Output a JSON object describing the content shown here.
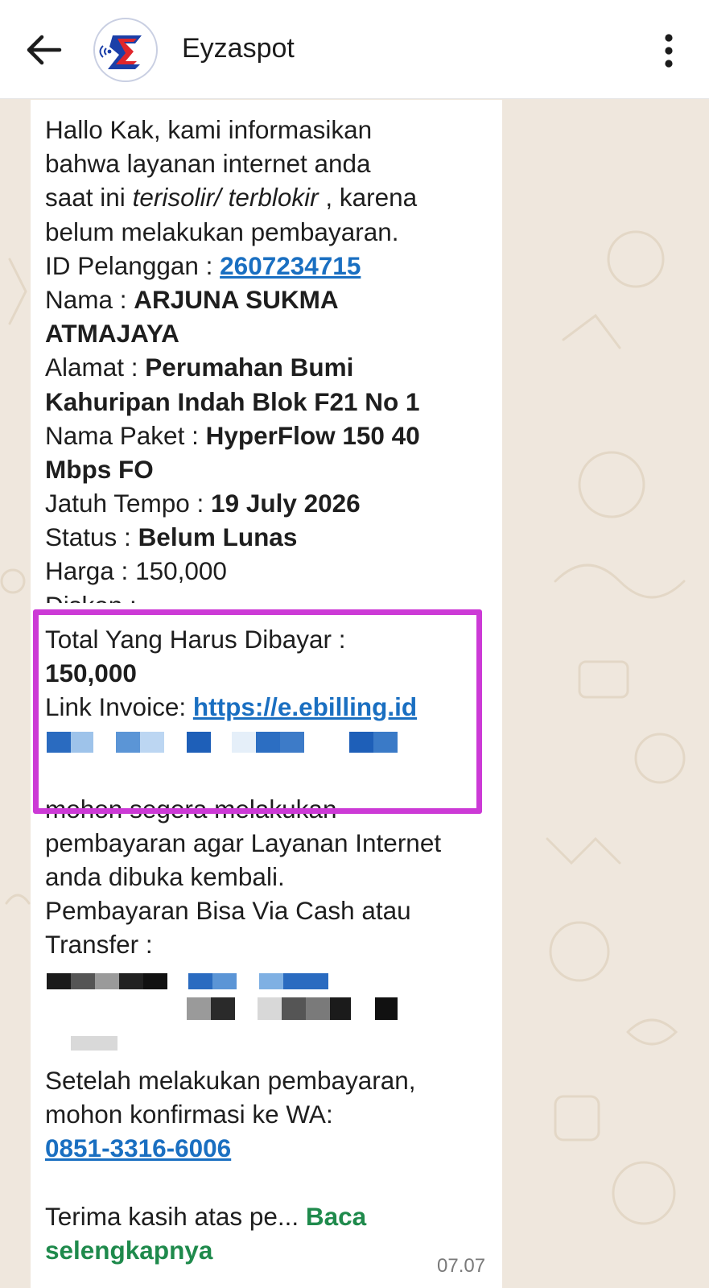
{
  "header": {
    "title": "Eyzaspot",
    "back_icon": "arrow-left-icon",
    "menu_icon": "more-vertical-icon",
    "avatar_icon": "eyzaspot-logo"
  },
  "message": {
    "intro": [
      "Hallo Kak, kami informasikan",
      "bahwa layanan internet anda"
    ],
    "status_line": {
      "pre": "saat ini ",
      "italic": "terisolir/ terblokir",
      "post": " , karena"
    },
    "intro_end": "belum melakukan pembayaran.",
    "customer_id": {
      "label": "ID Pelanggan : ",
      "value": "2607234715"
    },
    "name": {
      "label": "Nama : ",
      "value_line1": "ARJUNA SUKMA",
      "value_line2": "ATMAJAYA"
    },
    "address": {
      "label": "Alamat : ",
      "value_line1": "Perumahan Bumi",
      "value_line2": "Kahuripan Indah Blok F21 No 1"
    },
    "package": {
      "label": "Nama Paket : ",
      "value_line1": "HyperFlow 150 40",
      "value_line2": "Mbps FO"
    },
    "due_date": {
      "label": "Jatuh Tempo : ",
      "value": "19 July 2026"
    },
    "status": {
      "label": "Status : ",
      "value": "Belum Lunas"
    },
    "price": {
      "label": "Harga : ",
      "value": "150,000"
    },
    "discount": {
      "label": "Diskon : ",
      "value": "-"
    },
    "total": {
      "label": "Total Yang Harus Dibayar :",
      "value": "150,000"
    },
    "invoice": {
      "label": "Link Invoice: ",
      "value": "https://e.ebilling.id"
    },
    "request": [
      "mohon segera melakukan",
      "pembayaran agar Layanan Internet",
      "anda dibuka kembali."
    ],
    "payment": [
      "Pembayaran Bisa Via Cash atau",
      "Transfer :"
    ],
    "confirm": [
      "Setelah melakukan pembayaran,",
      "mohon konfirmasi ke WA:"
    ],
    "phone": "0851-3316-6006",
    "closing": "Terima kasih atas pe... ",
    "read_more_line1": "Baca",
    "read_more_line2": "selengkapnya",
    "time": "07.07"
  },
  "colors": {
    "link": "#1a6fc1",
    "read_more": "#1f8a4c",
    "highlight": "#cc3ad6",
    "wallpaper": "#efe7dd"
  }
}
